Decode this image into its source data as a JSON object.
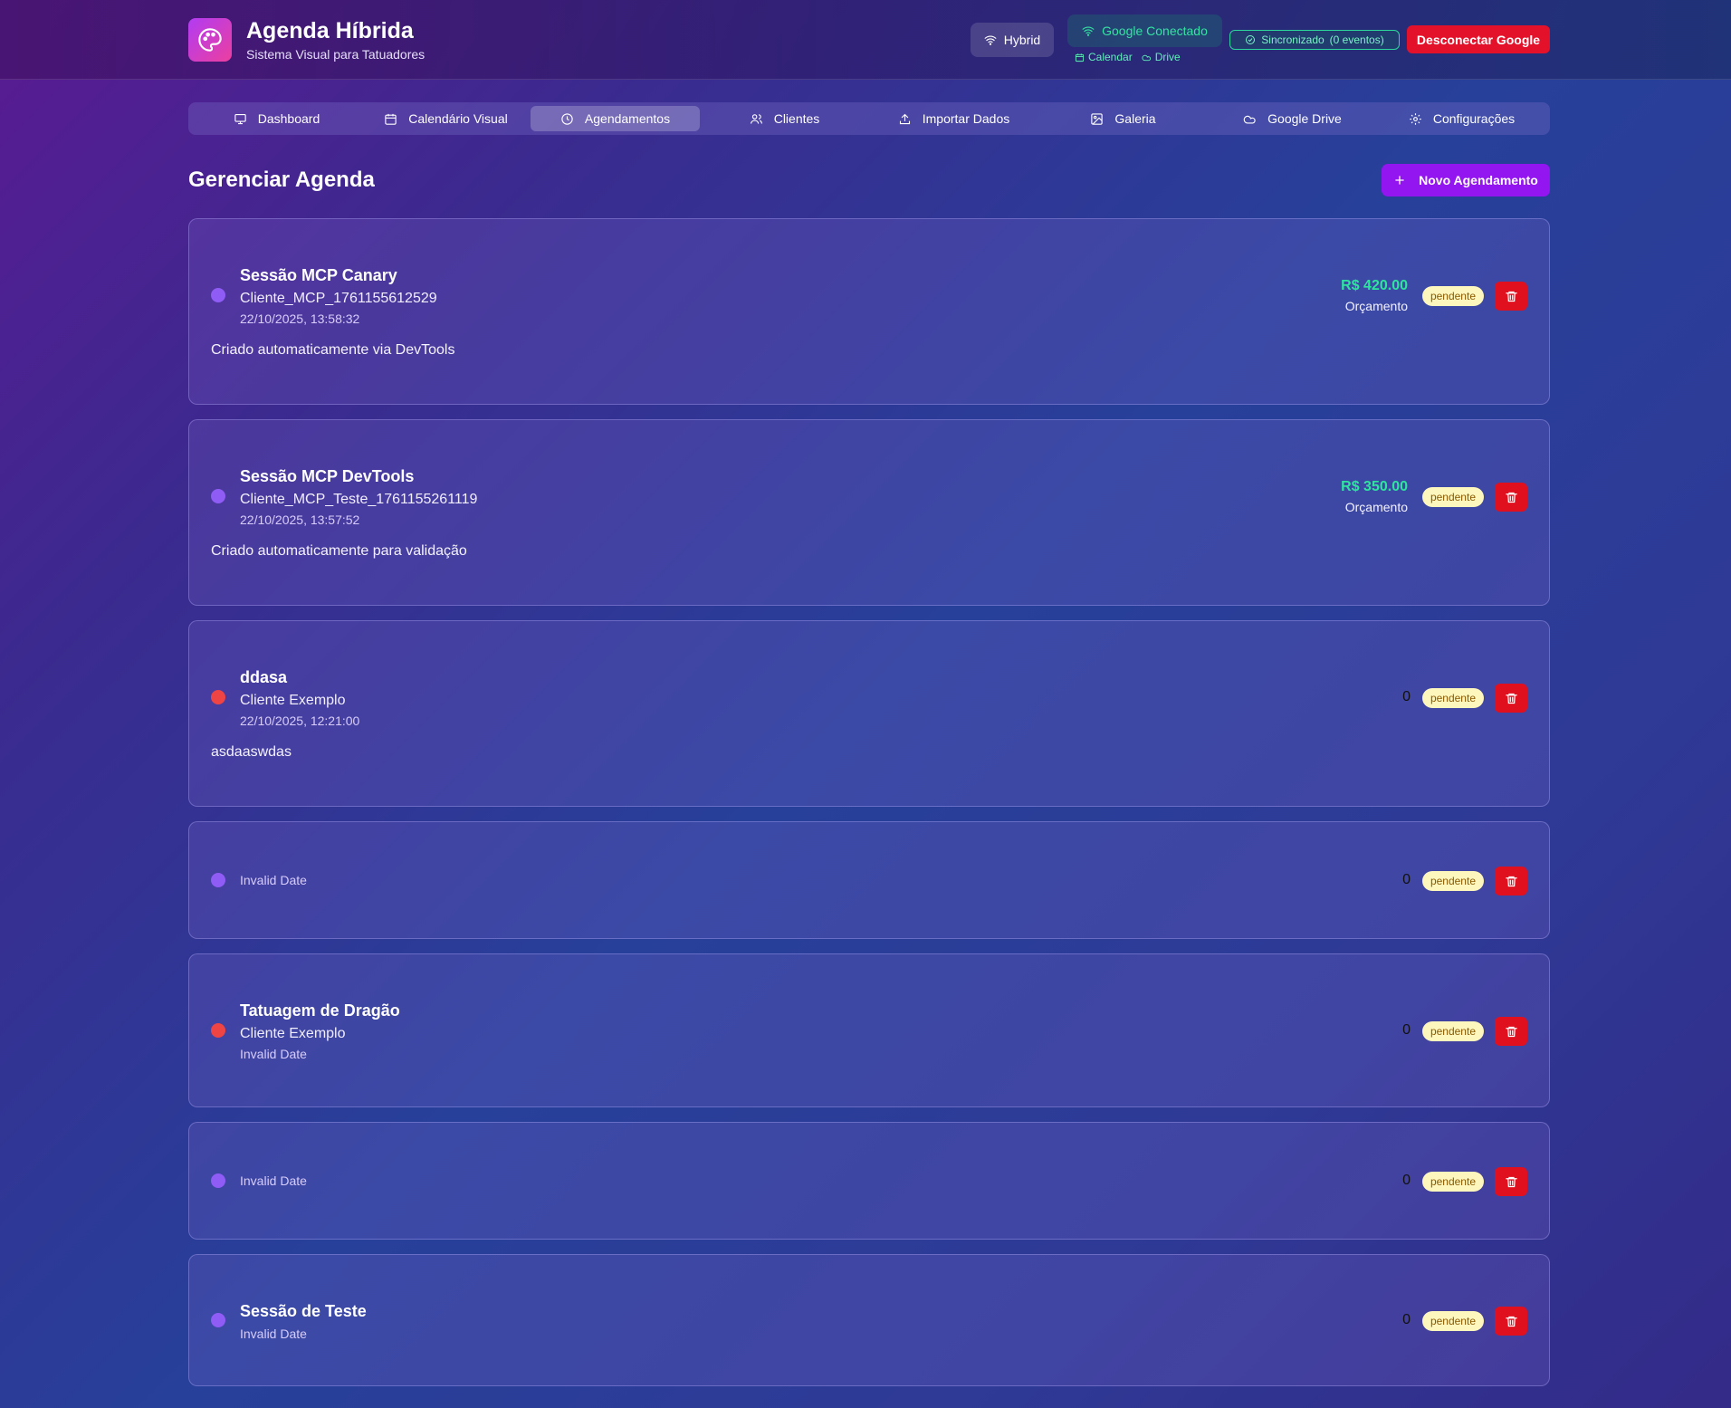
{
  "header": {
    "title": "Agenda Híbrida",
    "subtitle": "Sistema Visual para Tatuadores",
    "mode_label": "Hybrid",
    "google_status": "Google Conectado",
    "google_services": [
      "Calendar",
      "Drive"
    ],
    "sync_label": "Sincronizado",
    "sync_count": "(0 eventos)",
    "disconnect_label": "Desconectar Google"
  },
  "nav": {
    "active": "Agendamentos",
    "items": [
      {
        "label": "Dashboard",
        "icon": "monitor-icon"
      },
      {
        "label": "Calendário Visual",
        "icon": "calendar-icon"
      },
      {
        "label": "Agendamentos",
        "icon": "clock-icon"
      },
      {
        "label": "Clientes",
        "icon": "users-icon"
      },
      {
        "label": "Importar Dados",
        "icon": "upload-icon"
      },
      {
        "label": "Galeria",
        "icon": "image-icon"
      },
      {
        "label": "Google Drive",
        "icon": "cloud-icon"
      },
      {
        "label": "Configurações",
        "icon": "gear-icon"
      }
    ]
  },
  "main": {
    "title": "Gerenciar Agenda",
    "new_button": "Novo Agendamento",
    "appointments": [
      {
        "title": "Sessão MCP Canary",
        "client": "Cliente_MCP_1761155612529",
        "date": "22/10/2025, 13:58:32",
        "notes": "Criado automaticamente via DevTools",
        "price": "R$ 420.00",
        "price_label": "Orçamento",
        "status": "pendente",
        "dot": "purple"
      },
      {
        "title": "Sessão MCP DevTools",
        "client": "Cliente_MCP_Teste_1761155261119",
        "date": "22/10/2025, 13:57:52",
        "notes": "Criado automaticamente para validação",
        "price": "R$ 350.00",
        "price_label": "Orçamento",
        "status": "pendente",
        "dot": "purple"
      },
      {
        "title": "ddasa",
        "client": "Cliente Exemplo",
        "date": "22/10/2025, 12:21:00",
        "notes": "asdaaswdas",
        "value": "0",
        "status": "pendente",
        "dot": "red"
      },
      {
        "date": "Invalid Date",
        "value": "0",
        "status": "pendente",
        "dot": "purple"
      },
      {
        "title": "Tatuagem de Dragão",
        "client": "Cliente Exemplo",
        "date": "Invalid Date",
        "value": "0",
        "status": "pendente",
        "dot": "red"
      },
      {
        "date": "Invalid Date",
        "value": "0",
        "status": "pendente",
        "dot": "purple"
      },
      {
        "title": "Sessão de Teste",
        "date": "Invalid Date",
        "value": "0",
        "status": "pendente",
        "dot": "purple"
      }
    ]
  },
  "colors": {
    "accent": "#9315f0",
    "danger": "#e3112a",
    "success": "#2ee59e",
    "pending_bg": "#fdf6bd",
    "dot_purple": "#8f5cf5",
    "dot_red": "#ef4444"
  }
}
